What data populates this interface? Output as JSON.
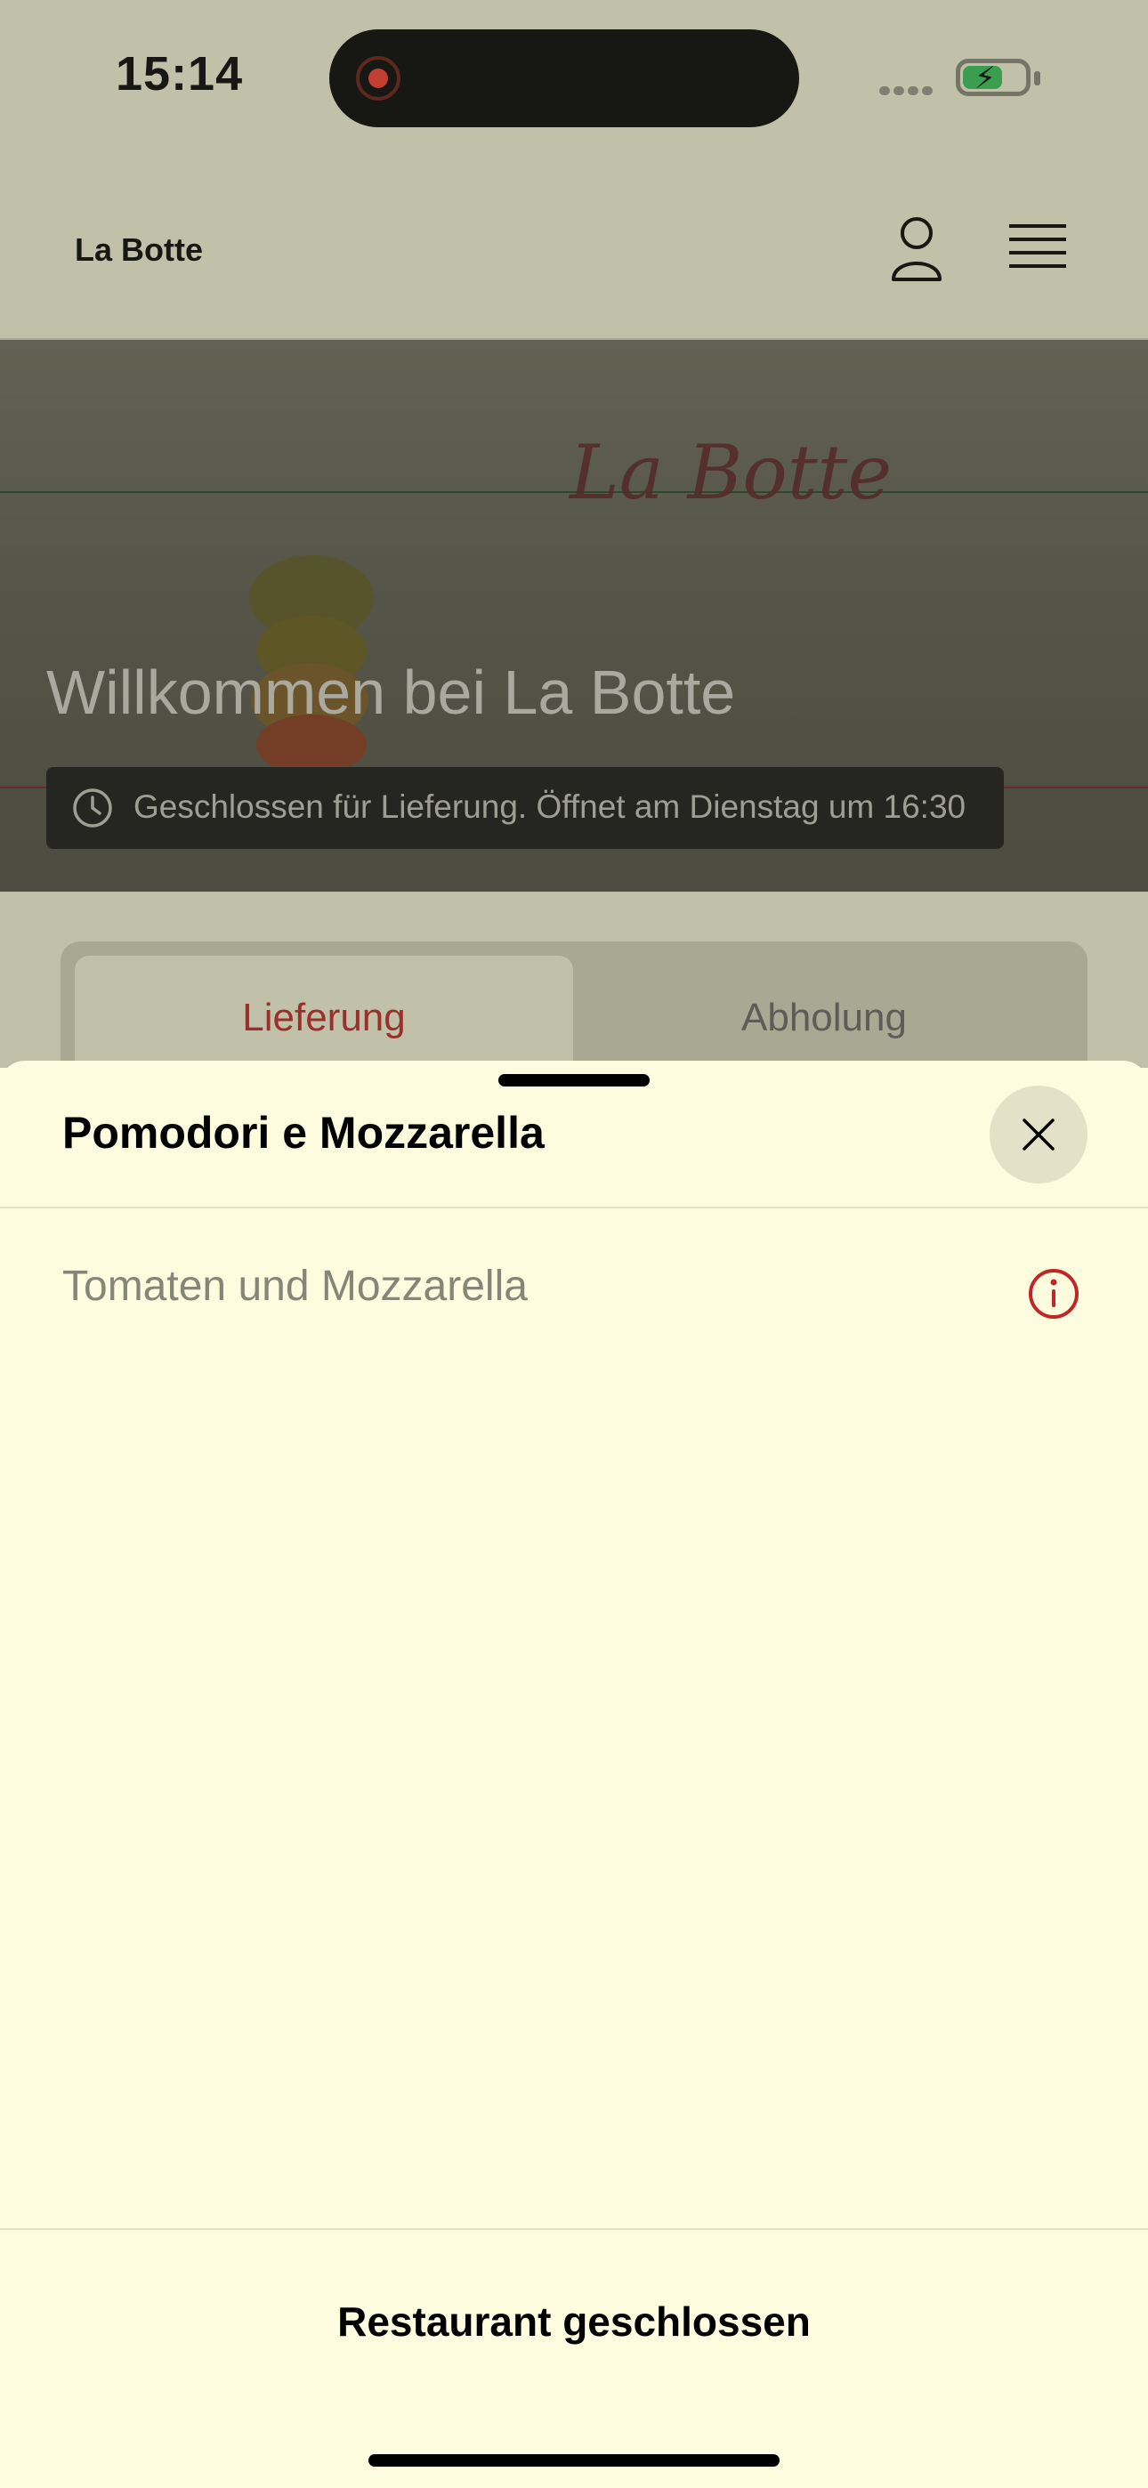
{
  "status_bar": {
    "time": "15:14",
    "battery_icon": "battery-charging-icon"
  },
  "header": {
    "brand": "La Botte"
  },
  "hero": {
    "script_logo": "La Botte",
    "title": "Willkommen bei La Botte",
    "hours": "Geschlossen für Lieferung. Öffnet am Dienstag um 16:30"
  },
  "order_tabs": {
    "delivery": "Lieferung",
    "pickup": "Abholung"
  },
  "sheet": {
    "title": "Pomodori e Mozzarella",
    "description": "Tomaten und Mozzarella",
    "footer_label": "Restaurant geschlossen"
  },
  "colors": {
    "accent_red": "#c12626",
    "sheet_bg": "#fdfcdf"
  }
}
